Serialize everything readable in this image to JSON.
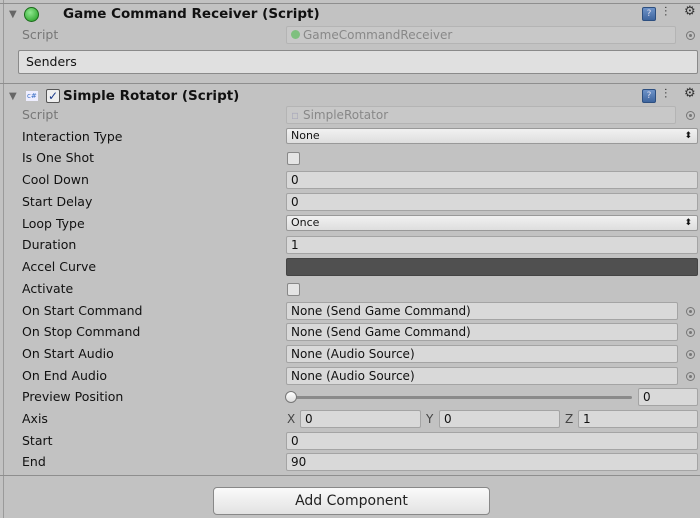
{
  "component1": {
    "title": "Game Command Receiver (Script)",
    "script_label": "Script",
    "script_value": "GameCommandReceiver",
    "senders_label": "Senders"
  },
  "component2": {
    "title": "Simple Rotator (Script)",
    "enabled": true,
    "fields": {
      "script": {
        "label": "Script",
        "value": "SimpleRotator"
      },
      "interaction_type": {
        "label": "Interaction Type",
        "value": "None"
      },
      "is_one_shot": {
        "label": "Is One Shot",
        "checked": false
      },
      "cool_down": {
        "label": "Cool Down",
        "value": "0"
      },
      "start_delay": {
        "label": "Start Delay",
        "value": "0"
      },
      "loop_type": {
        "label": "Loop Type",
        "value": "Once"
      },
      "duration": {
        "label": "Duration",
        "value": "1"
      },
      "accel_curve": {
        "label": "Accel Curve"
      },
      "activate": {
        "label": "Activate",
        "checked": false
      },
      "on_start_command": {
        "label": "On Start Command",
        "value": "None (Send Game Command)"
      },
      "on_stop_command": {
        "label": "On Stop Command",
        "value": "None (Send Game Command)"
      },
      "on_start_audio": {
        "label": "On Start Audio",
        "value": "None (Audio Source)"
      },
      "on_end_audio": {
        "label": "On End Audio",
        "value": "None (Audio Source)"
      },
      "preview_position": {
        "label": "Preview Position",
        "value": "0",
        "fraction": 0
      },
      "axis": {
        "label": "Axis",
        "x_label": "X",
        "x": "0",
        "y_label": "Y",
        "y": "0",
        "z_label": "Z",
        "z": "1"
      },
      "start": {
        "label": "Start",
        "value": "0"
      },
      "end": {
        "label": "End",
        "value": "90"
      }
    }
  },
  "add_component_label": "Add Component",
  "icons": {
    "help": "?",
    "preset": "preset-icon",
    "gear": "gear-icon",
    "csharp": "c#"
  }
}
